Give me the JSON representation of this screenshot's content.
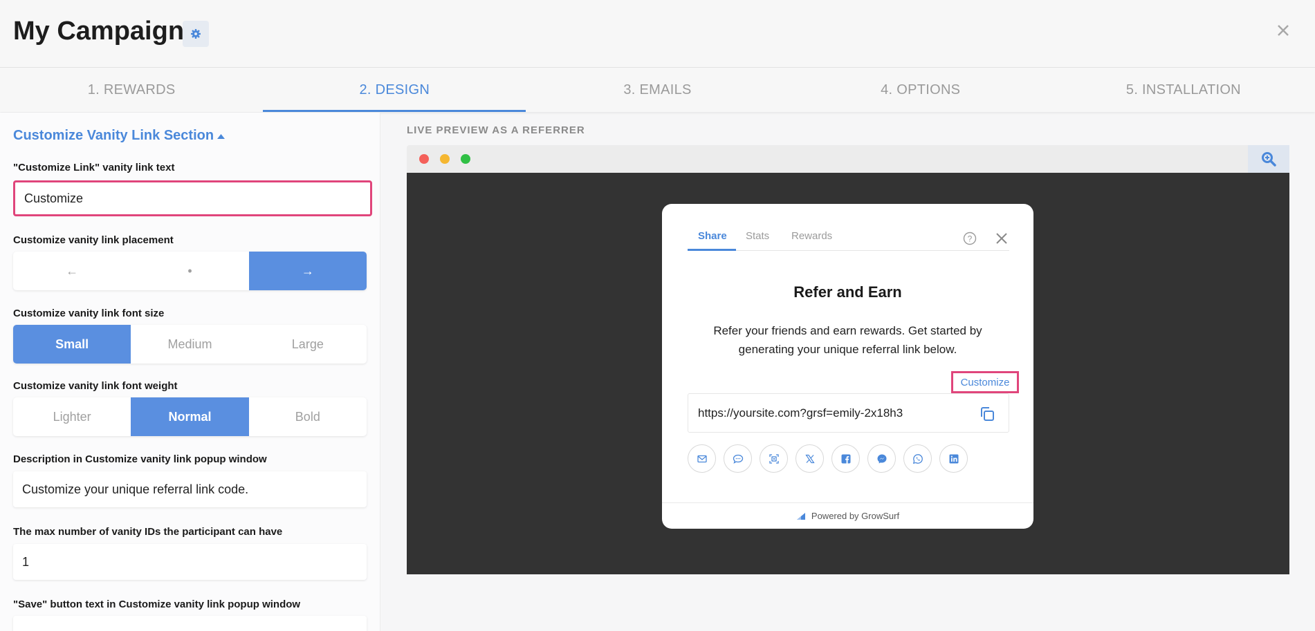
{
  "header": {
    "title": "My Campaign"
  },
  "tabs": [
    {
      "label": "1. REWARDS"
    },
    {
      "label": "2. DESIGN"
    },
    {
      "label": "3. EMAILS"
    },
    {
      "label": "4. OPTIONS"
    },
    {
      "label": "5. INSTALLATION"
    }
  ],
  "left": {
    "section_title": "Customize Vanity Link Section",
    "fields": {
      "link_text_label": "\"Customize Link\" vanity link text",
      "link_text_value": "Customize",
      "placement_label": "Customize vanity link placement",
      "placement_options": [
        "←",
        "•",
        "→"
      ],
      "font_size_label": "Customize vanity link font size",
      "font_size_options": [
        "Small",
        "Medium",
        "Large"
      ],
      "font_weight_label": "Customize vanity link font weight",
      "font_weight_options": [
        "Lighter",
        "Normal",
        "Bold"
      ],
      "description_label": "Description in Customize vanity link popup window",
      "description_value": "Customize your unique referral link code.",
      "max_ids_label": "The max number of vanity IDs the participant can have",
      "max_ids_value": "1",
      "save_label": "\"Save\" button text in Customize vanity link popup window"
    }
  },
  "preview": {
    "label": "LIVE PREVIEW AS A REFERRER",
    "popup": {
      "tabs": [
        "Share",
        "Stats",
        "Rewards"
      ],
      "title": "Refer and Earn",
      "description": "Refer your friends and earn rewards. Get started by generating your unique referral link below.",
      "customize_link": "Customize",
      "referral_link": "https://yoursite.com?grsf=emily-2x18h3",
      "social_icons": [
        "email-icon",
        "sms-icon",
        "qr-code-icon",
        "x-icon",
        "facebook-icon",
        "messenger-icon",
        "whatsapp-icon",
        "linkedin-icon"
      ],
      "footer": "Powered by GrowSurf"
    }
  },
  "colors": {
    "accent": "#4a88da",
    "selected_option": "#5a8fe0",
    "highlight": "#e0457b"
  }
}
